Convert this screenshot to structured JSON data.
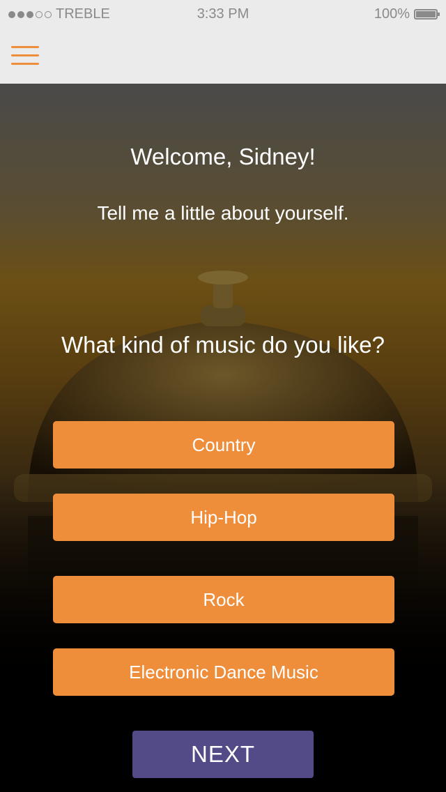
{
  "status_bar": {
    "carrier": "TREBLE",
    "signal_filled": 3,
    "signal_total": 5,
    "time": "3:33 PM",
    "battery": "100%",
    "battery_level": 1.0
  },
  "nav": {
    "menu_icon": "hamburger-menu-icon",
    "accent_color": "#ef8e3a"
  },
  "main": {
    "title": "Welcome, Sidney!",
    "subtitle": "Tell me a little about yourself.",
    "question": "What kind of music do you like?",
    "genres": [
      "Country",
      "Hip-Hop",
      "Rock",
      "Electronic Dance Music"
    ],
    "next_label": "NEXT"
  },
  "colors": {
    "status_bg": "#ebebeb",
    "genre_button": "#ef8e3a",
    "next_button": "#534a88"
  }
}
